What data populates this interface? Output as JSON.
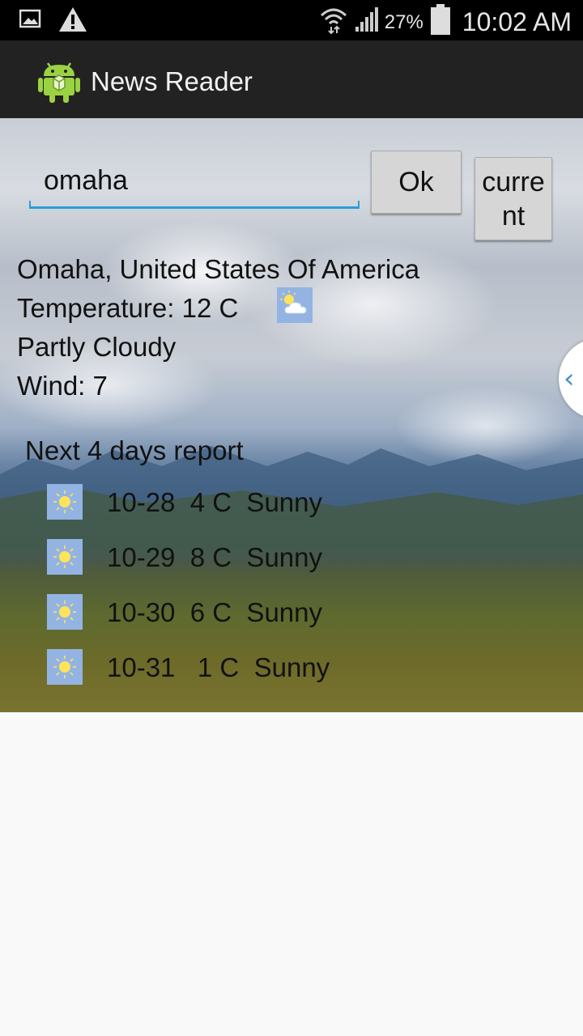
{
  "status_bar": {
    "icons_left": [
      "image-icon",
      "warning-icon"
    ],
    "icons_right": [
      "wifi-icon",
      "signal-icon",
      "battery-icon"
    ],
    "battery_percent": "27%",
    "time": "10:02 AM"
  },
  "app_bar": {
    "title": "News Reader",
    "icon": "android-icon"
  },
  "search": {
    "value": "omaha",
    "ok_label": "Ok",
    "current_label": "current"
  },
  "current": {
    "location": "Omaha, United States Of America",
    "temperature": "Temperature: 12 C",
    "condition": "Partly Cloudy",
    "wind": "Wind: 7",
    "icon": "partly-cloudy-icon"
  },
  "forecast": {
    "title": "Next 4 days report",
    "days": [
      {
        "text": "10-28  4 C  Sunny",
        "icon": "sunny-icon"
      },
      {
        "text": "10-29  8 C  Sunny",
        "icon": "sunny-icon"
      },
      {
        "text": "10-30  6 C  Sunny",
        "icon": "sunny-icon"
      },
      {
        "text": "10-31   1 C  Sunny",
        "icon": "sunny-icon"
      }
    ]
  },
  "colors": {
    "status_bar": "#000000",
    "action_bar": "#222222",
    "accent": "#2a9fd6",
    "button": "#d6d6d6",
    "icon_bg": "#93b4e3"
  }
}
